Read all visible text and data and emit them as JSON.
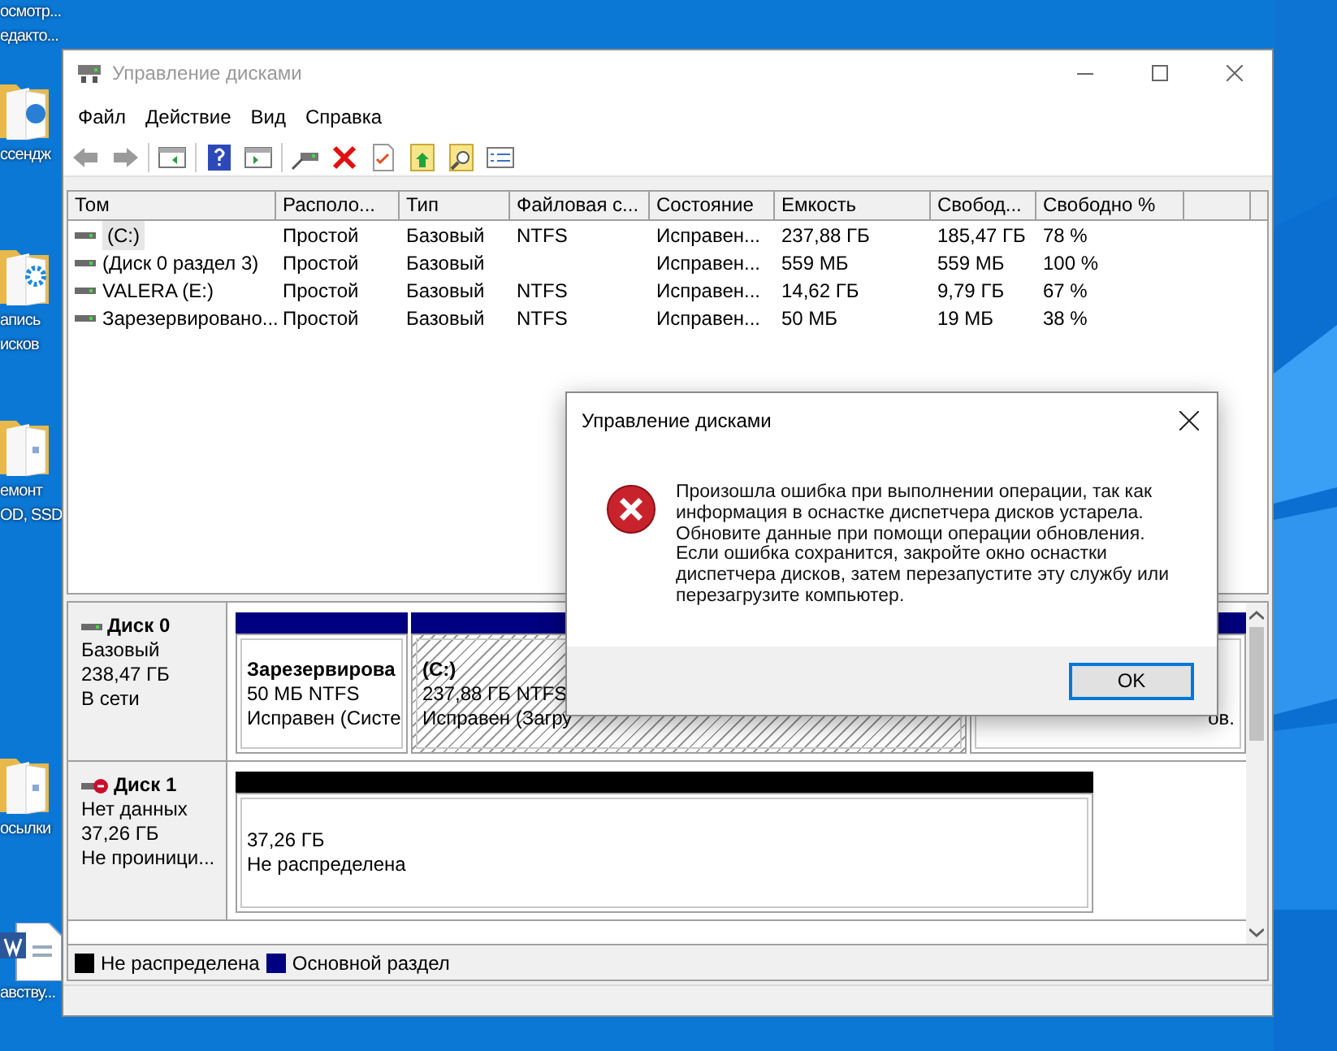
{
  "desktop_icons": [
    {
      "kind": "none",
      "lines": [
        "осмотр...",
        "едакто..."
      ]
    },
    {
      "kind": "media_folder",
      "lines": [
        "ссендж"
      ]
    },
    {
      "kind": "gear_folder",
      "lines": [
        "апись",
        "исков"
      ]
    },
    {
      "kind": "folder",
      "lines": [
        "емонт",
        "OD, SSD"
      ]
    },
    {
      "kind": "folder",
      "lines": [
        "осылки"
      ]
    },
    {
      "kind": "document",
      "lines": [
        "авству..."
      ]
    }
  ],
  "window": {
    "title": "Управление дисками",
    "active": false,
    "menu": [
      "Файл",
      "Действие",
      "Вид",
      "Справка"
    ],
    "table": {
      "columns": [
        "Том",
        "Располо...",
        "Тип",
        "Файловая с...",
        "Состояние",
        "Емкость",
        "Свобод...",
        "Свободно %"
      ],
      "rows": [
        {
          "selected": true,
          "cells": [
            "(C:)",
            "Простой",
            "Базовый",
            "NTFS",
            "Исправен...",
            "237,88 ГБ",
            "185,47 ГБ",
            "78 %"
          ]
        },
        {
          "selected": false,
          "cells": [
            "(Диск 0 раздел 3)",
            "Простой",
            "Базовый",
            "",
            "Исправен...",
            "559 МБ",
            "559 МБ",
            "100 %"
          ]
        },
        {
          "selected": false,
          "cells": [
            "VALERA (E:)",
            "Простой",
            "Базовый",
            "NTFS",
            "Исправен...",
            "14,62 ГБ",
            "9,79 ГБ",
            "67 %"
          ]
        },
        {
          "selected": false,
          "cells": [
            "Зарезервировано...",
            "Простой",
            "Базовый",
            "NTFS",
            "Исправен...",
            "50 МБ",
            "19 МБ",
            "38 %"
          ]
        }
      ]
    },
    "disks": [
      {
        "name": "Диск 0",
        "kind": "online",
        "lines": [
          "Базовый",
          "238,47 ГБ",
          "В сети"
        ],
        "partitions": [
          {
            "kind": "primary",
            "selected": false,
            "title": "Зарезервирова",
            "size": "50 МБ NTFS",
            "status": "Исправен (Систе"
          },
          {
            "kind": "primary",
            "selected": true,
            "title": "(C:)",
            "size": "237,88 ГБ NTFS",
            "status": "Исправен (Загру"
          },
          {
            "kind": "primary",
            "selected": false,
            "status": "ов."
          }
        ]
      },
      {
        "name": "Диск 1",
        "kind": "not_initialized",
        "lines": [
          "Нет данных",
          "37,26 ГБ",
          "Не проиници..."
        ],
        "partitions": [
          {
            "kind": "unallocated",
            "selected": false,
            "size": "37,26 ГБ",
            "status": "Не распределена"
          }
        ]
      }
    ],
    "legend": [
      {
        "label": "Не распределена",
        "color": "#000000"
      },
      {
        "label": "Основной раздел",
        "color": "#000080"
      }
    ]
  },
  "dialog": {
    "title": "Управление дисками",
    "kind": "error",
    "message": "Произошла ошибка при выполнении операции, так как информация в оснастке диспетчера дисков устарела. Обновите данные при помощи операции обновления. Если ошибка сохранится, закройте окно оснастки диспетчера дисков, затем перезапустите эту службу или перезагрузите компьютер.",
    "button": "OK"
  }
}
